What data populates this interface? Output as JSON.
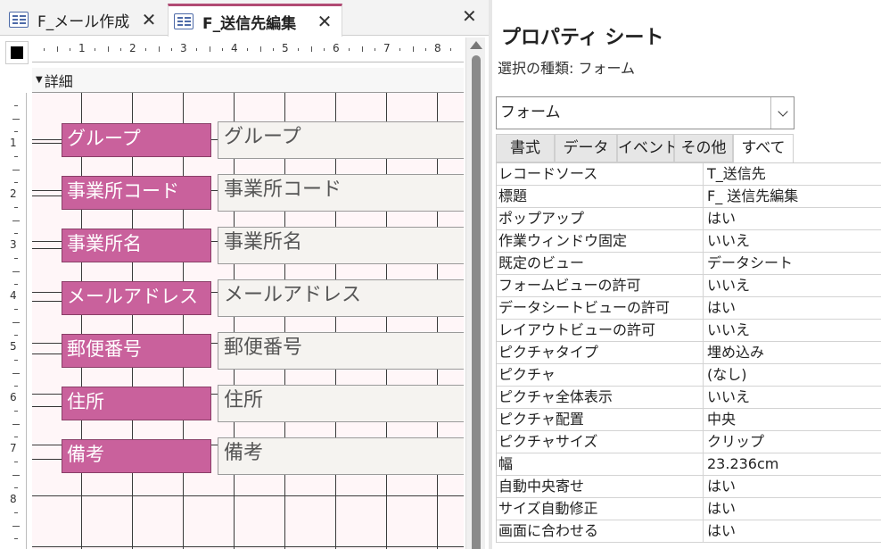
{
  "tabs": [
    {
      "label": "F_メール作成",
      "close": "✕"
    },
    {
      "label": "F_送信先編集",
      "close": "✕"
    }
  ],
  "doc_close": "✕",
  "ruler": {
    "h": [
      "1",
      "2",
      "3",
      "4",
      "5",
      "6",
      "7",
      "8"
    ],
    "v": [
      "1",
      "2",
      "3",
      "4",
      "5",
      "6",
      "7",
      "8"
    ]
  },
  "section": {
    "marker": "▼",
    "title": "詳細"
  },
  "controls": [
    {
      "label": "グループ",
      "field": "グループ"
    },
    {
      "label": "事業所コード",
      "field": "事業所コード"
    },
    {
      "label": "事業所名",
      "field": "事業所名"
    },
    {
      "label": "メールアドレス",
      "field": "メールアドレス"
    },
    {
      "label": "郵便番号",
      "field": "郵便番号"
    },
    {
      "label": "住所",
      "field": "住所"
    },
    {
      "label": "備考",
      "field": "備考"
    }
  ],
  "property_sheet": {
    "title": "プロパティ シート",
    "selection_type": "選択の種類: フォーム",
    "selected_object": "フォーム",
    "tabs": [
      "書式",
      "データ",
      "イベント",
      "その他",
      "すべて"
    ],
    "active_tab": "すべて",
    "rows": [
      {
        "name": "レコードソース",
        "value": "T_送信先"
      },
      {
        "name": "標題",
        "value": "F_ 送信先編集"
      },
      {
        "name": "ポップアップ",
        "value": "はい"
      },
      {
        "name": "作業ウィンドウ固定",
        "value": "いいえ"
      },
      {
        "name": "既定のビュー",
        "value": "データシート"
      },
      {
        "name": "フォームビューの許可",
        "value": "いいえ"
      },
      {
        "name": "データシートビューの許可",
        "value": "はい"
      },
      {
        "name": "レイアウトビューの許可",
        "value": "いいえ"
      },
      {
        "name": "ピクチャタイプ",
        "value": "埋め込み"
      },
      {
        "name": "ピクチャ",
        "value": "(なし)"
      },
      {
        "name": "ピクチャ全体表示",
        "value": "いいえ"
      },
      {
        "name": "ピクチャ配置",
        "value": "中央"
      },
      {
        "name": "ピクチャサイズ",
        "value": "クリップ"
      },
      {
        "name": "幅",
        "value": "23.236cm"
      },
      {
        "name": "自動中央寄せ",
        "value": "はい"
      },
      {
        "name": "サイズ自動修正",
        "value": "はい"
      },
      {
        "name": "画面に合わせる",
        "value": "はい"
      }
    ]
  },
  "colors": {
    "label_bg": "#c9619c",
    "tab_accent": "#b14a73",
    "grid_bg": "#fff6f8"
  }
}
